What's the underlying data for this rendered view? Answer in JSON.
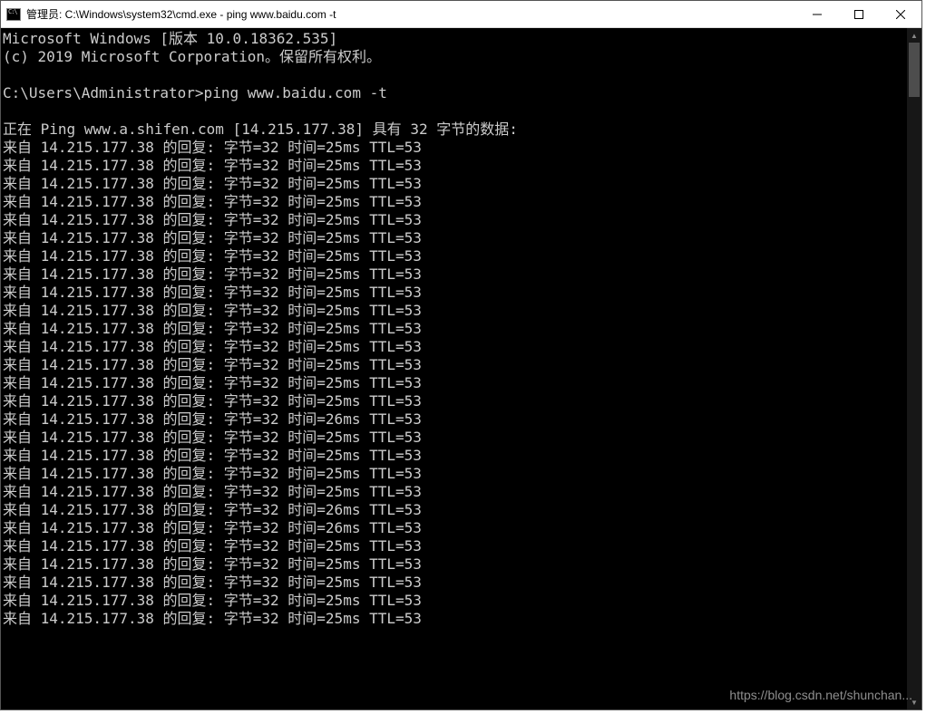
{
  "titlebar": {
    "title": "管理员: C:\\Windows\\system32\\cmd.exe - ping  www.baidu.com -t"
  },
  "console": {
    "header_line1": "Microsoft Windows [版本 10.0.18362.535]",
    "header_line2": "(c) 2019 Microsoft Corporation。保留所有权利。",
    "prompt": "C:\\Users\\Administrator>",
    "command": "ping www.baidu.com -t",
    "ping_header": "正在 Ping www.a.shifen.com [14.215.177.38] 具有 32 字节的数据:",
    "ip": "14.215.177.38",
    "bytes": 32,
    "ttl": 53,
    "replies": [
      {
        "time_ms": 25
      },
      {
        "time_ms": 25
      },
      {
        "time_ms": 25
      },
      {
        "time_ms": 25
      },
      {
        "time_ms": 25
      },
      {
        "time_ms": 25
      },
      {
        "time_ms": 25
      },
      {
        "time_ms": 25
      },
      {
        "time_ms": 25
      },
      {
        "time_ms": 25
      },
      {
        "time_ms": 25
      },
      {
        "time_ms": 25
      },
      {
        "time_ms": 25
      },
      {
        "time_ms": 25
      },
      {
        "time_ms": 25
      },
      {
        "time_ms": 26
      },
      {
        "time_ms": 25
      },
      {
        "time_ms": 25
      },
      {
        "time_ms": 25
      },
      {
        "time_ms": 25
      },
      {
        "time_ms": 26
      },
      {
        "time_ms": 26
      },
      {
        "time_ms": 25
      },
      {
        "time_ms": 25
      },
      {
        "time_ms": 25
      },
      {
        "time_ms": 25
      },
      {
        "time_ms": 25
      }
    ]
  },
  "watermark": "https://blog.csdn.net/shunchan..."
}
